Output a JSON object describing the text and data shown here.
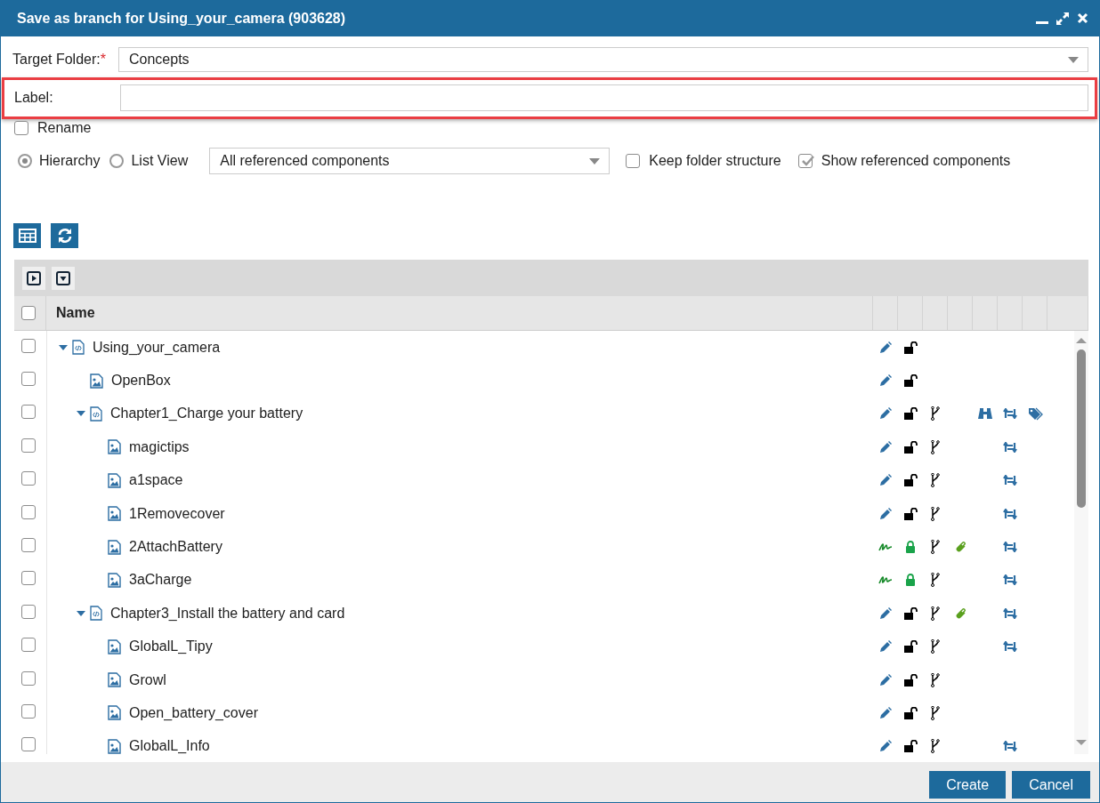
{
  "window": {
    "title": "Save as branch for Using_your_camera (903628)"
  },
  "target_folder": {
    "label": "Target Folder:",
    "required_mark": "*",
    "value": "Concepts"
  },
  "label_field": {
    "label": "Label:",
    "highlighted": true
  },
  "rename": {
    "label": "Rename",
    "checked": false
  },
  "view_modes": [
    {
      "label": "Hierarchy",
      "selected": true
    },
    {
      "label": "List View",
      "selected": false
    }
  ],
  "filter": {
    "value": "All referenced components"
  },
  "options": [
    {
      "label": "Keep folder structure",
      "checked": false
    },
    {
      "label": "Show referenced components",
      "checked": true
    }
  ],
  "tree": {
    "columns": [
      {
        "label": "Name"
      }
    ],
    "header_checked": false,
    "rows": [
      {
        "name": "Using_your_camera",
        "kind": "topic",
        "checked": false,
        "expanded": true,
        "signed": false,
        "locked": false,
        "branch": false,
        "attachment": false,
        "binoculars": false,
        "sync": false,
        "tag": false,
        "children": [
          {
            "name": "OpenBox",
            "kind": "image",
            "checked": false,
            "signed": false,
            "locked": false,
            "branch": false,
            "attachment": false,
            "binoculars": false,
            "sync": false,
            "tag": false
          },
          {
            "name": "Chapter1_Charge your battery",
            "kind": "topic",
            "checked": false,
            "expanded": true,
            "signed": false,
            "locked": false,
            "branch": true,
            "attachment": false,
            "binoculars": true,
            "sync": true,
            "tag": true,
            "children": [
              {
                "name": "magictips",
                "kind": "image",
                "checked": false,
                "signed": false,
                "locked": false,
                "branch": true,
                "attachment": false,
                "binoculars": false,
                "sync": true,
                "tag": false
              },
              {
                "name": "a1space",
                "kind": "image",
                "checked": false,
                "signed": false,
                "locked": false,
                "branch": true,
                "attachment": false,
                "binoculars": false,
                "sync": true,
                "tag": false
              },
              {
                "name": "1Removecover",
                "kind": "image",
                "checked": false,
                "signed": false,
                "locked": false,
                "branch": true,
                "attachment": false,
                "binoculars": false,
                "sync": true,
                "tag": false
              },
              {
                "name": "2AttachBattery",
                "kind": "image",
                "checked": false,
                "signed": true,
                "locked": true,
                "branch": true,
                "attachment": true,
                "binoculars": false,
                "sync": true,
                "tag": false
              },
              {
                "name": "3aCharge",
                "kind": "image",
                "checked": false,
                "signed": true,
                "locked": true,
                "branch": true,
                "attachment": false,
                "binoculars": false,
                "sync": true,
                "tag": false
              }
            ]
          },
          {
            "name": "Chapter3_Install the battery and card",
            "kind": "topic",
            "checked": false,
            "expanded": true,
            "signed": false,
            "locked": false,
            "branch": true,
            "attachment": true,
            "binoculars": false,
            "sync": true,
            "tag": false,
            "children": [
              {
                "name": "GlobalL_Tipy",
                "kind": "image",
                "checked": false,
                "signed": false,
                "locked": false,
                "branch": true,
                "attachment": false,
                "binoculars": false,
                "sync": true,
                "tag": false
              },
              {
                "name": "Growl",
                "kind": "image",
                "checked": false,
                "signed": false,
                "locked": false,
                "branch": true,
                "attachment": false,
                "binoculars": false,
                "sync": false,
                "tag": false
              },
              {
                "name": "Open_battery_cover",
                "kind": "image",
                "checked": false,
                "signed": false,
                "locked": false,
                "branch": true,
                "attachment": false,
                "binoculars": false,
                "sync": false,
                "tag": false
              },
              {
                "name": "GlobalL_Info",
                "kind": "image",
                "checked": false,
                "signed": false,
                "locked": false,
                "branch": true,
                "attachment": false,
                "binoculars": false,
                "sync": true,
                "tag": false
              }
            ]
          }
        ]
      }
    ]
  },
  "buttons": [
    {
      "label": "Create"
    },
    {
      "label": "Cancel"
    }
  ]
}
